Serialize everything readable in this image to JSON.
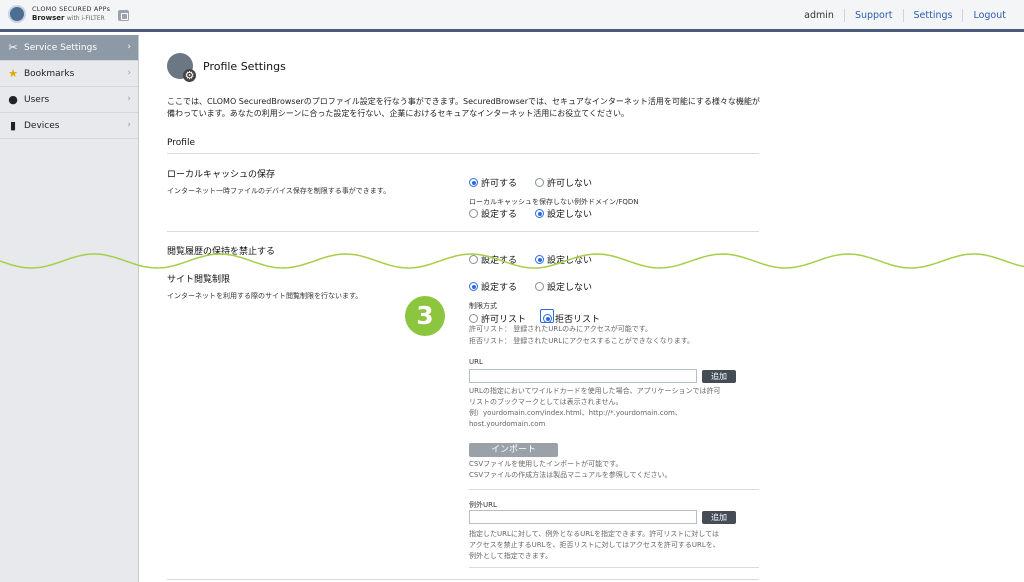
{
  "brand": {
    "line1": "CLOMO SECURED APPs",
    "line2": "Browser",
    "line2_suffix": "with i-FILTER"
  },
  "topnav": {
    "user": "admin",
    "support": "Support",
    "settings": "Settings",
    "logout": "Logout"
  },
  "sidebar": {
    "items": [
      {
        "label": "Service Settings",
        "icon": "wrench-icon",
        "active": true
      },
      {
        "label": "Bookmarks",
        "icon": "star-icon",
        "active": false
      },
      {
        "label": "Users",
        "icon": "user-icon",
        "active": false
      },
      {
        "label": "Devices",
        "icon": "device-icon",
        "active": false
      }
    ]
  },
  "page": {
    "title": "Profile Settings",
    "intro": "ここでは、CLOMO SecuredBrowserのプロファイル設定を行なう事ができます。SecuredBrowserでは、セキュアなインターネット活用を可能にする様々な機能が備わっています。あなたの利用シーンに合った設定を行ない、企業におけるセキュアなインターネット活用にお役立てください。",
    "section": "Profile"
  },
  "cache": {
    "label": "ローカルキャッシュの保存",
    "desc": "インターネット一時ファイルのデバイス保存を制限する事ができます。",
    "allow": "許可する",
    "deny": "許可しない",
    "exception_label": "ローカルキャッシュを保存しない例外ドメイン/FQDN",
    "set": "設定する",
    "unset": "設定しない"
  },
  "history": {
    "label": "閲覧履歴の保持を禁止する",
    "set": "設定する",
    "unset": "設定しない"
  },
  "restrict": {
    "label": "サイト閲覧制限",
    "desc": "インターネットを利用する際のサイト閲覧制限を行ないます。",
    "set": "設定する",
    "unset": "設定しない",
    "method_label": "制限方式",
    "allowlist": "許可リスト",
    "denylist": "拒否リスト",
    "allowlist_help": "許可リスト： 登録されたURLのみにアクセスが可能です。",
    "denylist_help": "拒否リスト： 登録されたURLにアクセスすることができなくなります。",
    "url_label": "URL",
    "add": "追加",
    "url_help_1": "URLの指定においてワイルドカードを使用した場合、アプリケーションでは許可",
    "url_help_2": "リストのブックマークとしては表示されません。",
    "url_help_3": "例）yourdomain.com/index.html、http://*.yourdomain.com、",
    "url_help_4": "host.yourdomain.com",
    "import": "インポート",
    "import_help_1": "CSVファイルを使用したインポートが可能です。",
    "import_help_2": "CSVファイルの作成方法は製品マニュアルを参照してください。",
    "exception_url_label": "例外URL",
    "exception_add": "追加",
    "exception_help_1": "指定したURLに対して、例外となるURLを指定できます。許可リストに対しては",
    "exception_help_2": "アクセスを禁止するURLを、拒否リストに対してはアクセスを許可するURLを、",
    "exception_help_3": "例外として指定できます。"
  },
  "step_badge": "3",
  "colors": {
    "accent": "#2d6cdf",
    "badge": "#8cc63f",
    "wave": "#a6cf45",
    "sidebar_active": "#8e99a6"
  }
}
